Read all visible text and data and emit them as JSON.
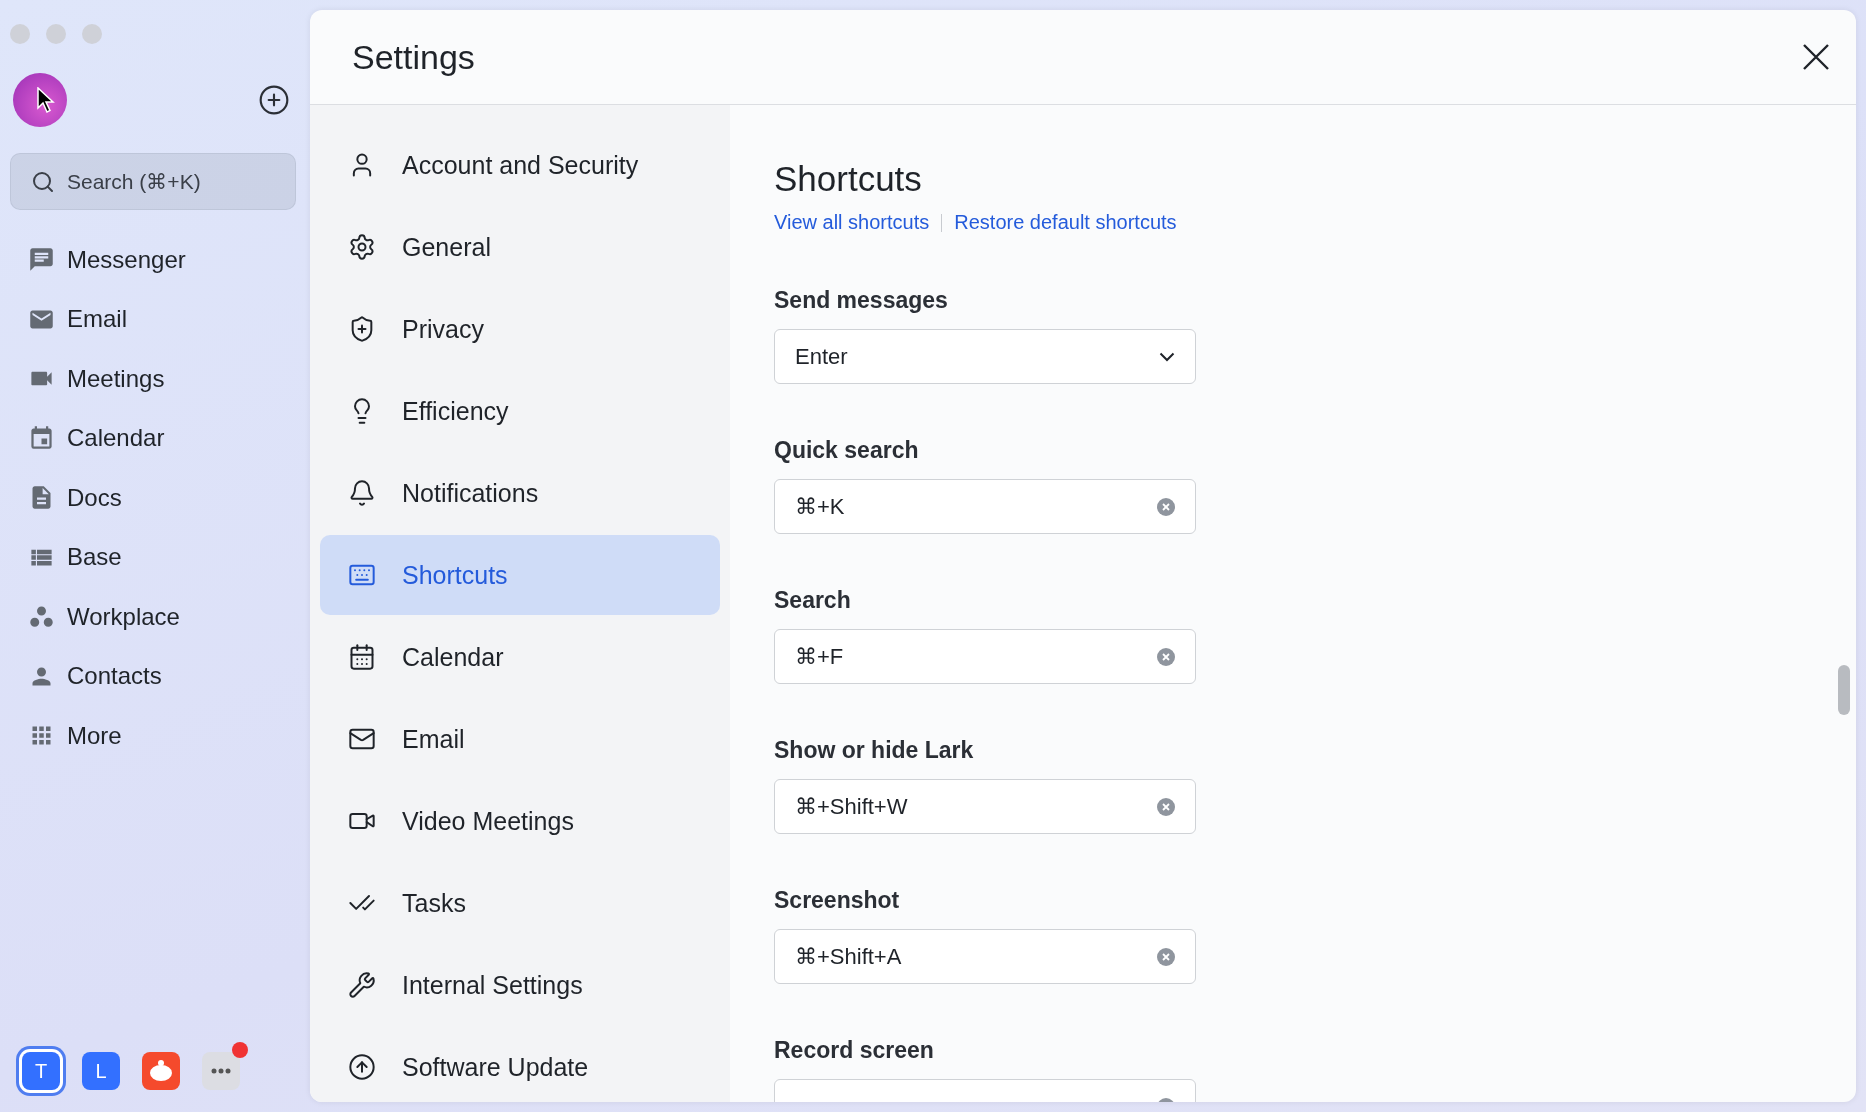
{
  "sidebar": {
    "search": {
      "placeholder": "Search (⌘+K)"
    },
    "items": [
      {
        "label": "Messenger"
      },
      {
        "label": "Email"
      },
      {
        "label": "Meetings"
      },
      {
        "label": "Calendar"
      },
      {
        "label": "Docs"
      },
      {
        "label": "Base"
      },
      {
        "label": "Workplace"
      },
      {
        "label": "Contacts"
      },
      {
        "label": "More"
      }
    ],
    "apps": [
      {
        "kind": "letter",
        "label": "T",
        "selected": true
      },
      {
        "kind": "letter",
        "label": "L",
        "selected": false
      },
      {
        "kind": "logo",
        "selected": false
      },
      {
        "kind": "more",
        "selected": false,
        "unread": true
      }
    ]
  },
  "settings": {
    "title": "Settings",
    "nav": [
      {
        "label": "Account and Security",
        "selected": false
      },
      {
        "label": "General",
        "selected": false
      },
      {
        "label": "Privacy",
        "selected": false
      },
      {
        "label": "Efficiency",
        "selected": false
      },
      {
        "label": "Notifications",
        "selected": false
      },
      {
        "label": "Shortcuts",
        "selected": true
      },
      {
        "label": "Calendar",
        "selected": false
      },
      {
        "label": "Email",
        "selected": false
      },
      {
        "label": "Video Meetings",
        "selected": false
      },
      {
        "label": "Tasks",
        "selected": false
      },
      {
        "label": "Internal Settings",
        "selected": false
      },
      {
        "label": "Software Update",
        "selected": false
      }
    ],
    "content": {
      "title": "Shortcuts",
      "links": [
        "View all shortcuts",
        "Restore default shortcuts"
      ],
      "shortcuts": [
        {
          "label": "Send messages",
          "kind": "select",
          "value": "Enter"
        },
        {
          "label": "Quick search",
          "kind": "key",
          "value": "⌘+K"
        },
        {
          "label": "Search",
          "kind": "key",
          "value": "⌘+F"
        },
        {
          "label": "Show or hide Lark",
          "kind": "key",
          "value": "⌘+Shift+W"
        },
        {
          "label": "Screenshot",
          "kind": "key",
          "value": "⌘+Shift+A"
        },
        {
          "label": "Record screen",
          "kind": "key"
        }
      ]
    }
  }
}
